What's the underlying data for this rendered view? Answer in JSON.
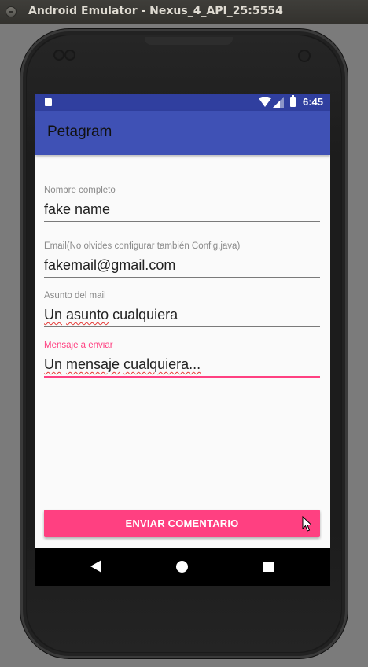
{
  "window": {
    "title": "Android Emulator - Nexus_4_API_25:5554"
  },
  "statusbar": {
    "time": "6:45"
  },
  "app": {
    "title": "Petagram"
  },
  "form": {
    "name": {
      "label": "Nombre completo",
      "value": "fake name"
    },
    "email": {
      "label": "Email(No olvides configurar también Config.java)",
      "value": "fakemail@gmail.com"
    },
    "subject": {
      "label": "Asunto del mail",
      "words": [
        "Un",
        "asunto",
        "cualquiera"
      ]
    },
    "message": {
      "label": "Mensaje a enviar",
      "words": [
        "Un",
        "mensaje",
        "cualquiera..."
      ]
    }
  },
  "button": {
    "label": "ENVIAR COMENTARIO"
  },
  "colors": {
    "primary": "#3f51b5",
    "primary_dark": "#303f9f",
    "accent": "#ff4081"
  },
  "icons": {
    "status": [
      "sd-card-icon",
      "wifi-icon",
      "signal-icon",
      "battery-icon"
    ],
    "nav": [
      "back-icon",
      "home-icon",
      "recents-icon"
    ]
  }
}
